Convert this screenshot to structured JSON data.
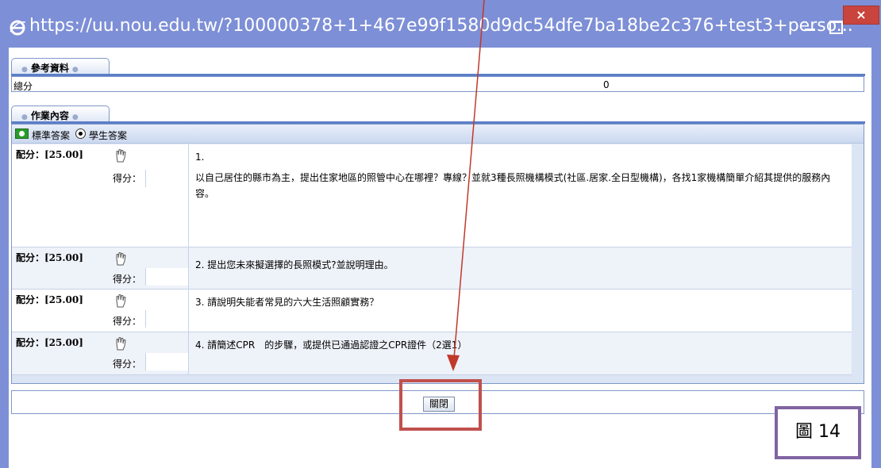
{
  "window": {
    "title": "https://uu.nou.edu.tw/?100000378+1+467e99f1580d9dc54dfe7ba18be2c376+test3+perso...",
    "close_glyph": "×",
    "icons": {
      "browser": "ie-icon",
      "minimize": "minimize-icon",
      "maximize": "maximize-icon",
      "close": "close-icon"
    }
  },
  "reference": {
    "tab_label": "參考資料",
    "total_label": "總分",
    "total_value": "0"
  },
  "homework": {
    "tab_label": "作業內容",
    "standard_answer_label": "標準答案",
    "student_answer_label": "學生答案",
    "selected_option": "學生答案",
    "score_label": "得分：",
    "questions": [
      {
        "points": "配分：[25.00]",
        "number": "1.",
        "text": "以自己居住的縣市為主，提出住家地區的照管中心在哪裡？專線？並就3種長照機構模式(社區.居家.全日型機構)，各找1家機構簡單介紹其提供的服務內容。"
      },
      {
        "points": "配分：[25.00]",
        "text": "2. 提出您未來擬選擇的長照模式?並說明理由。"
      },
      {
        "points": "配分：[25.00]",
        "text": "3. 請說明失能者常見的六大生活照顧實務？"
      },
      {
        "points": "配分：[25.00]",
        "text": "4. 請簡述CPR　的步驟，或提供已通過認證之CPR證件（2選1）"
      }
    ]
  },
  "close_button_label": "關閉",
  "figure_label": "圖 14",
  "colors": {
    "highlight": "#c0504d",
    "figure_border": "#8064a2",
    "arrow": "#c0392b",
    "titlebar": "#7d8fd6"
  }
}
